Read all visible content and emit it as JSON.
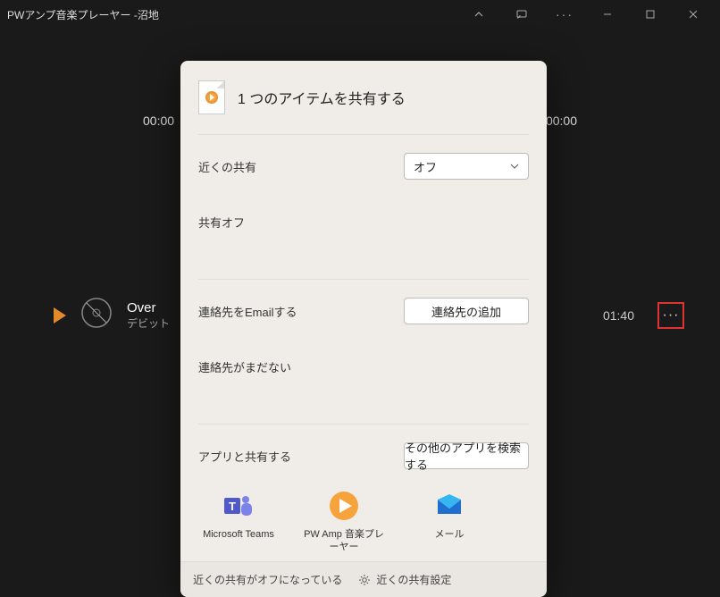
{
  "window": {
    "title": "PWアンプ音楽プレーヤー -沼地"
  },
  "player": {
    "time_left": "00:00",
    "time_right": "00:00",
    "track_title": "Over",
    "track_artist": "デビット",
    "track_duration": "01:40"
  },
  "share": {
    "title": "1 つのアイテムを共有する",
    "nearby_label": "近くの共有",
    "nearby_value": "オフ",
    "nearby_status": "共有オフ",
    "email_label": "連絡先をEmailする",
    "add_contact": "連絡先の追加",
    "no_contacts": "連絡先がまだない",
    "apps_label": "アプリと共有する",
    "find_more_apps": "その他のアプリを検索する",
    "apps": {
      "teams": "Microsoft Teams",
      "pwamp": "PW Amp 音楽プレーヤー",
      "mail": "メール"
    },
    "footer_off": "近くの共有がオフになっている",
    "footer_settings": "近くの共有設定"
  }
}
